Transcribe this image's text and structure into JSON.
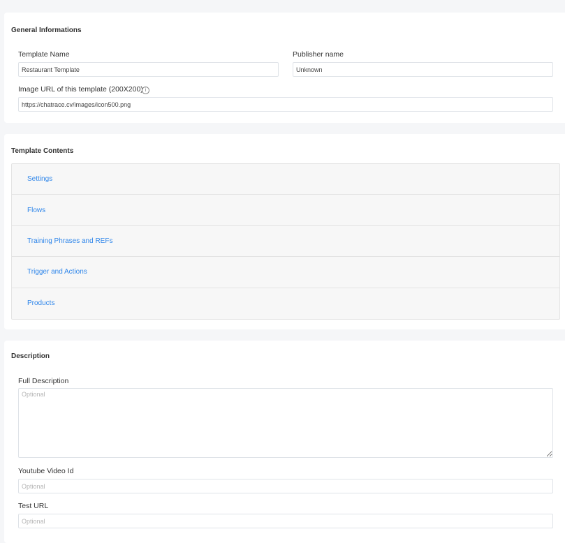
{
  "general": {
    "title": "General Informations",
    "template_name_label": "Template Name",
    "template_name_value": "Restaurant Template",
    "publisher_label": "Publisher name",
    "publisher_value": "Unknown",
    "image_url_label": "Image URL of this template (200X200)",
    "info_icon_glyph": "i",
    "image_url_value": "https://chatrace.cv/images/icon500.png"
  },
  "contents": {
    "title": "Template Contents",
    "items": [
      {
        "label": "Settings"
      },
      {
        "label": "Flows"
      },
      {
        "label": "Training Phrases and REFs"
      },
      {
        "label": "Trigger and Actions"
      },
      {
        "label": "Products"
      }
    ]
  },
  "description": {
    "title": "Description",
    "full_description_label": "Full Description",
    "full_description_placeholder": "Optional",
    "youtube_label": "Youtube Video Id",
    "youtube_placeholder": "Optional",
    "test_url_label": "Test URL",
    "test_url_placeholder": "Optional"
  },
  "colors": {
    "link": "#2f86ea",
    "page_bg": "#f5f6f8",
    "card_bg": "#ffffff"
  }
}
